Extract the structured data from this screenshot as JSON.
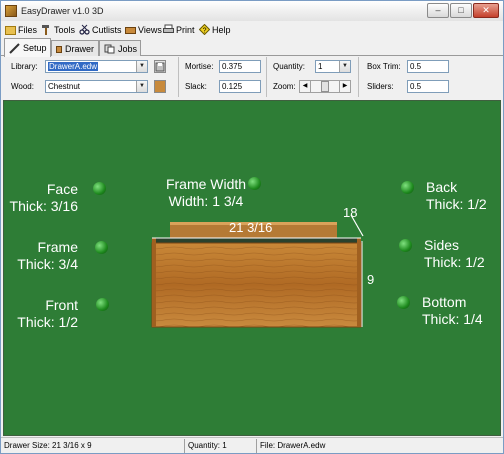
{
  "window": {
    "title": "EasyDrawer v1.0 3D"
  },
  "menu": {
    "files": "Files",
    "tools": "Tools",
    "cutlists": "Cutlists",
    "views": "Views",
    "print": "Print",
    "help": "Help"
  },
  "tabs": {
    "setup": "Setup",
    "drawer": "Drawer",
    "jobs": "Jobs"
  },
  "fields": {
    "library_label": "Library:",
    "library_value": "DrawerA.edw",
    "wood_label": "Wood:",
    "wood_value": "Chestnut",
    "mortise_label": "Mortise:",
    "mortise_value": "0.375",
    "slack_label": "Slack:",
    "slack_value": "0.125",
    "quantity_label": "Quantity:",
    "quantity_value": "1",
    "zoom_label": "Zoom:",
    "boxtrim_label": "Box Trim:",
    "boxtrim_value": "0.5",
    "sliders_label": "Sliders:",
    "sliders_value": "0.5"
  },
  "canvas": {
    "face_title": "Face",
    "face_value": "Thick: 3/16",
    "frame_title": "Frame",
    "frame_value": "Thick: 3/4",
    "front_title": "Front",
    "front_value": "Thick: 1/2",
    "frame_width_title": "Frame Width",
    "frame_width_value": "Width: 1 3/4",
    "back_title": "Back",
    "back_value": "Thick: 1/2",
    "sides_title": "Sides",
    "sides_value": "Thick: 1/2",
    "bottom_title": "Bottom",
    "bottom_value": "Thick: 1/4",
    "dim_width": "21 3/16",
    "dim_depth": "18",
    "dim_height": "9"
  },
  "status": {
    "size": "Drawer Size: 21 3/16 x 9",
    "quantity": "Quantity: 1",
    "file": "File: DrawerA.edw"
  },
  "colors": {
    "canvas_bg": "#2e7d36",
    "dot": "#1e8a1e",
    "wood": "#b8742c",
    "selection": "#316ac5"
  }
}
